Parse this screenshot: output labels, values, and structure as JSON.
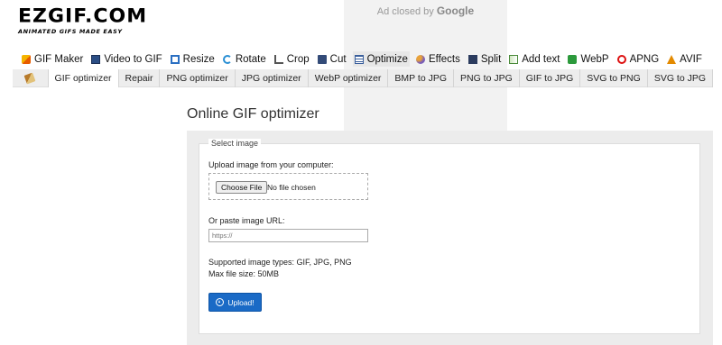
{
  "logo": {
    "main": "EZGIF.COM",
    "tagline": "ANIMATED GIFS MADE EASY"
  },
  "ad": {
    "text_prefix": "Ad closed by",
    "text_brand": "Google"
  },
  "main_nav": [
    {
      "label": "GIF Maker",
      "icon": "gif-maker-icon"
    },
    {
      "label": "Video to GIF",
      "icon": "video-icon"
    },
    {
      "label": "Resize",
      "icon": "resize-icon"
    },
    {
      "label": "Rotate",
      "icon": "rotate-icon"
    },
    {
      "label": "Crop",
      "icon": "crop-icon"
    },
    {
      "label": "Cut",
      "icon": "cut-icon"
    },
    {
      "label": "Optimize",
      "icon": "optimize-icon",
      "active": true
    },
    {
      "label": "Effects",
      "icon": "effects-icon"
    },
    {
      "label": "Split",
      "icon": "split-icon"
    },
    {
      "label": "Add text",
      "icon": "add-text-icon"
    },
    {
      "label": "WebP",
      "icon": "webp-icon"
    },
    {
      "label": "APNG",
      "icon": "apng-icon"
    },
    {
      "label": "AVIF",
      "icon": "avif-icon"
    }
  ],
  "sub_nav": [
    {
      "label": "GIF optimizer",
      "active": true
    },
    {
      "label": "Repair"
    },
    {
      "label": "PNG optimizer"
    },
    {
      "label": "JPG optimizer"
    },
    {
      "label": "WebP optimizer"
    },
    {
      "label": "BMP to JPG"
    },
    {
      "label": "PNG to JPG"
    },
    {
      "label": "GIF to JPG"
    },
    {
      "label": "SVG to PNG"
    },
    {
      "label": "SVG to JPG"
    }
  ],
  "page_title": "Online GIF optimizer",
  "form": {
    "legend": "Select image",
    "upload_label": "Upload image from your computer:",
    "choose_file": "Choose File",
    "no_file": "No file chosen",
    "url_label": "Or paste image URL:",
    "url_placeholder": "https://",
    "supported_types": "Supported image types: GIF, JPG, PNG",
    "max_size": "Max file size: 50MB",
    "upload_button": "Upload!"
  }
}
